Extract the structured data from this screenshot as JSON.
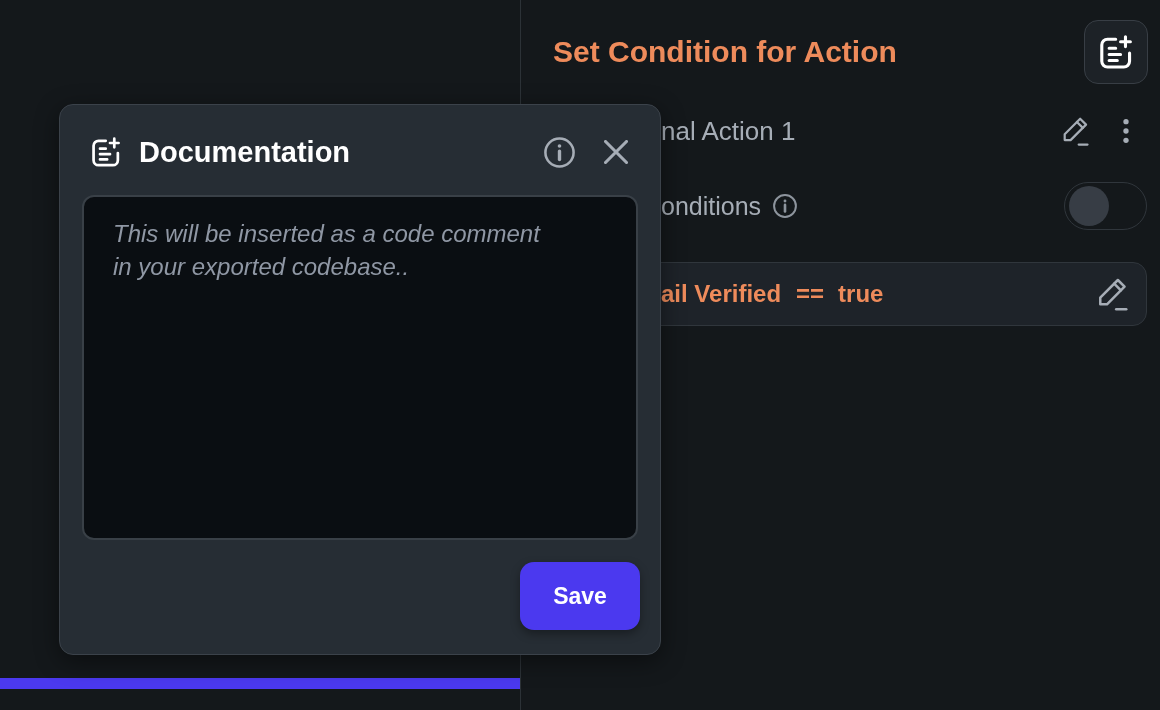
{
  "condition_panel": {
    "title": "Set Condition for Action",
    "action": {
      "label": "nal Action 1"
    },
    "conditions_toggle": {
      "label": "onditions",
      "on": false
    },
    "condition": {
      "field": "ail Verified",
      "operator": "==",
      "value": "true"
    }
  },
  "documentation_dialog": {
    "title": "Documentation",
    "comment_field": {
      "placeholder": "This will be inserted as a code comment in your exported codebase.."
    },
    "buttons": [
      "Save"
    ]
  }
}
